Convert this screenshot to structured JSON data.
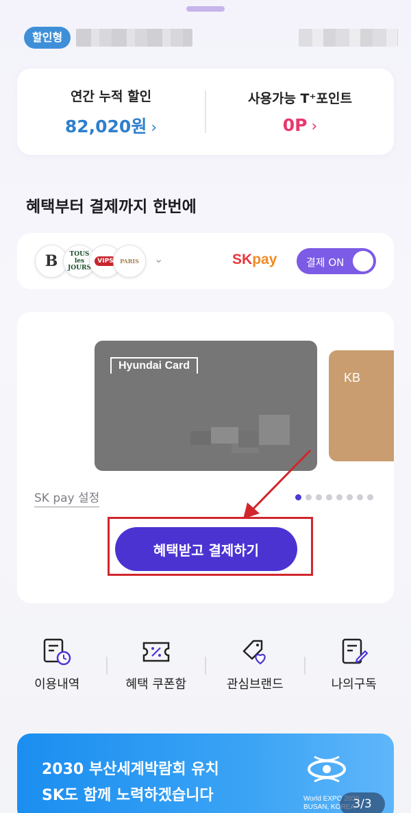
{
  "header": {
    "badge": "할인형"
  },
  "stats": {
    "annual_label": "연간 누적 할인",
    "annual_value": "82,020원",
    "points_label": "사용가능 T⁺포인트",
    "points_value": "0P",
    "chevron": "›"
  },
  "section_title": "혜택부터 결제까지 한번에",
  "brands": {
    "logos": [
      "B",
      "TOUS les JOURS",
      "VIPS",
      "PARIS"
    ],
    "chevron": "⌄",
    "skpay_sk": "SK",
    "skpay_pay": "pay",
    "toggle_label": "결제 ON",
    "toggle_on": true
  },
  "card_section": {
    "card_brand": "Hyundai Card",
    "next_card_brand": "KB",
    "sk_setting": "SK pay 설정",
    "page_dots": 8,
    "active_dot": 0,
    "pay_button": "혜택받고 결제하기"
  },
  "quick_menu": [
    {
      "icon": "usage-history-icon",
      "label": "이용내역"
    },
    {
      "icon": "coupon-icon",
      "label": "혜택 쿠폰함"
    },
    {
      "icon": "favorite-brand-icon",
      "label": "관심브랜드"
    },
    {
      "icon": "subscription-icon",
      "label": "나의구독"
    }
  ],
  "banner": {
    "line1": "2030 부산세계박람회 유치",
    "line2": "SK도 함께 노력하겠습니다",
    "expo_line1": "World EXPO 2030",
    "expo_line2": "BUSAN, KOREA",
    "pager": "3/3"
  },
  "colors": {
    "accent": "#4b33d2",
    "toggle": "#7c5be6",
    "discount_blue": "#2f7fcd",
    "points_pink": "#e8386e",
    "annotation_red": "#d0262c"
  }
}
